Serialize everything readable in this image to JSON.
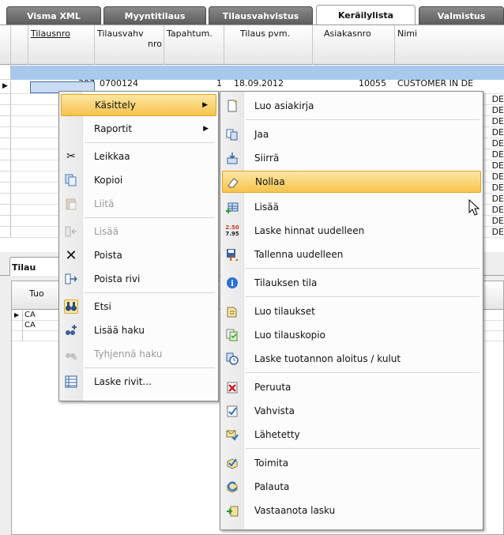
{
  "tabs": [
    "Visma XML",
    "Myyntitilaus",
    "Tilausvahvistus",
    "Keräilylista",
    "Valmistus"
  ],
  "main_grid": {
    "headers": [
      {
        "line1": "Tilausnro",
        "line2": ""
      },
      {
        "line1": "Tilausvahv",
        "line2": "nro"
      },
      {
        "line1": "Tapahtum.",
        "line2": ""
      },
      {
        "line1": "Tilaus pvm.",
        "line2": ""
      },
      {
        "line1": "Asiakasnro",
        "line2": ""
      },
      {
        "line1": "Nimi",
        "line2": ""
      }
    ],
    "first_row": {
      "tilausnro": "307",
      "tilausvahv": "0700124",
      "tapahtum": "1",
      "pvm": "18.09.2012",
      "asiakasnro": "10055",
      "nimi": "CUSTOMER IN DE"
    },
    "row_tail": "DE"
  },
  "lower_panel": {
    "tab_label": "Tilau",
    "column_label": "Tuo",
    "rows": [
      "CA",
      "CA"
    ]
  },
  "context_menu": [
    {
      "label": "Käsittely",
      "icon": "none",
      "state": "highlighted",
      "submenu": true
    },
    {
      "label": "Raportit",
      "icon": "none",
      "state": "normal",
      "submenu": true
    },
    {
      "label": "Leikkaa",
      "icon": "scissors-icon",
      "state": "normal",
      "submenu": false
    },
    {
      "label": "Kopioi",
      "icon": "copy-icon",
      "state": "normal",
      "submenu": false
    },
    {
      "label": "Liitä",
      "icon": "paste-icon",
      "state": "disabled",
      "submenu": false
    },
    {
      "label": "Lisää",
      "icon": "insert-row-icon",
      "state": "disabled",
      "submenu": false
    },
    {
      "label": "Poista",
      "icon": "x-delete-icon",
      "state": "normal",
      "submenu": false
    },
    {
      "label": "Poista rivi",
      "icon": "delete-row-icon",
      "state": "normal",
      "submenu": false
    },
    {
      "label": "Etsi",
      "icon": "binoculars-icon",
      "state": "framed",
      "submenu": false
    },
    {
      "label": "Lisää haku",
      "icon": "add-search-icon",
      "state": "normal",
      "submenu": false
    },
    {
      "label": "Tyhjennä haku",
      "icon": "clear-search-icon",
      "state": "disabled",
      "submenu": false
    },
    {
      "label": "Laske rivit...",
      "icon": "count-rows-icon",
      "state": "normal",
      "submenu": false
    }
  ],
  "submenu": [
    {
      "label": "Luo asiakirja",
      "icon": "new-document-icon",
      "state": "normal"
    },
    {
      "label": "Jaa",
      "icon": "split-icon",
      "state": "normal"
    },
    {
      "label": "Siirrä",
      "icon": "move-icon",
      "state": "normal"
    },
    {
      "label": "Nollaa",
      "icon": "eraser-icon",
      "state": "highlighted"
    },
    {
      "label": "Lisää",
      "icon": "add-grid-icon",
      "state": "normal"
    },
    {
      "label": "Laske hinnat uudelleen",
      "icon": "price-recalc-icon",
      "state": "normal",
      "icon_text": "2.50\n7.95"
    },
    {
      "label": "Tallenna uudelleen",
      "icon": "save-again-icon",
      "state": "normal"
    },
    {
      "label": "Tilauksen tila",
      "icon": "info-icon",
      "state": "normal"
    },
    {
      "label": "Luo tilaukset",
      "icon": "create-orders-icon",
      "state": "normal"
    },
    {
      "label": "Luo tilauskopio",
      "icon": "copy-order-icon",
      "state": "normal"
    },
    {
      "label": "Laske tuotannon aloitus / kulut",
      "icon": "clock-icon",
      "state": "normal"
    },
    {
      "label": "Peruuta",
      "icon": "cancel-icon",
      "state": "normal"
    },
    {
      "label": "Vahvista",
      "icon": "confirm-icon",
      "state": "normal"
    },
    {
      "label": "Lähetetty",
      "icon": "sent-icon",
      "state": "normal"
    },
    {
      "label": "Toimita",
      "icon": "deliver-icon",
      "state": "normal"
    },
    {
      "label": "Palauta",
      "icon": "return-icon",
      "state": "normal"
    },
    {
      "label": "Vastaanota lasku",
      "icon": "receive-invoice-icon",
      "state": "normal"
    }
  ],
  "colors": {
    "tab_inactive": "#6f6f6f",
    "highlight_top": "#fde7a3",
    "highlight_bottom": "#f6c34e",
    "selection_blue": "#a9c9ec"
  }
}
